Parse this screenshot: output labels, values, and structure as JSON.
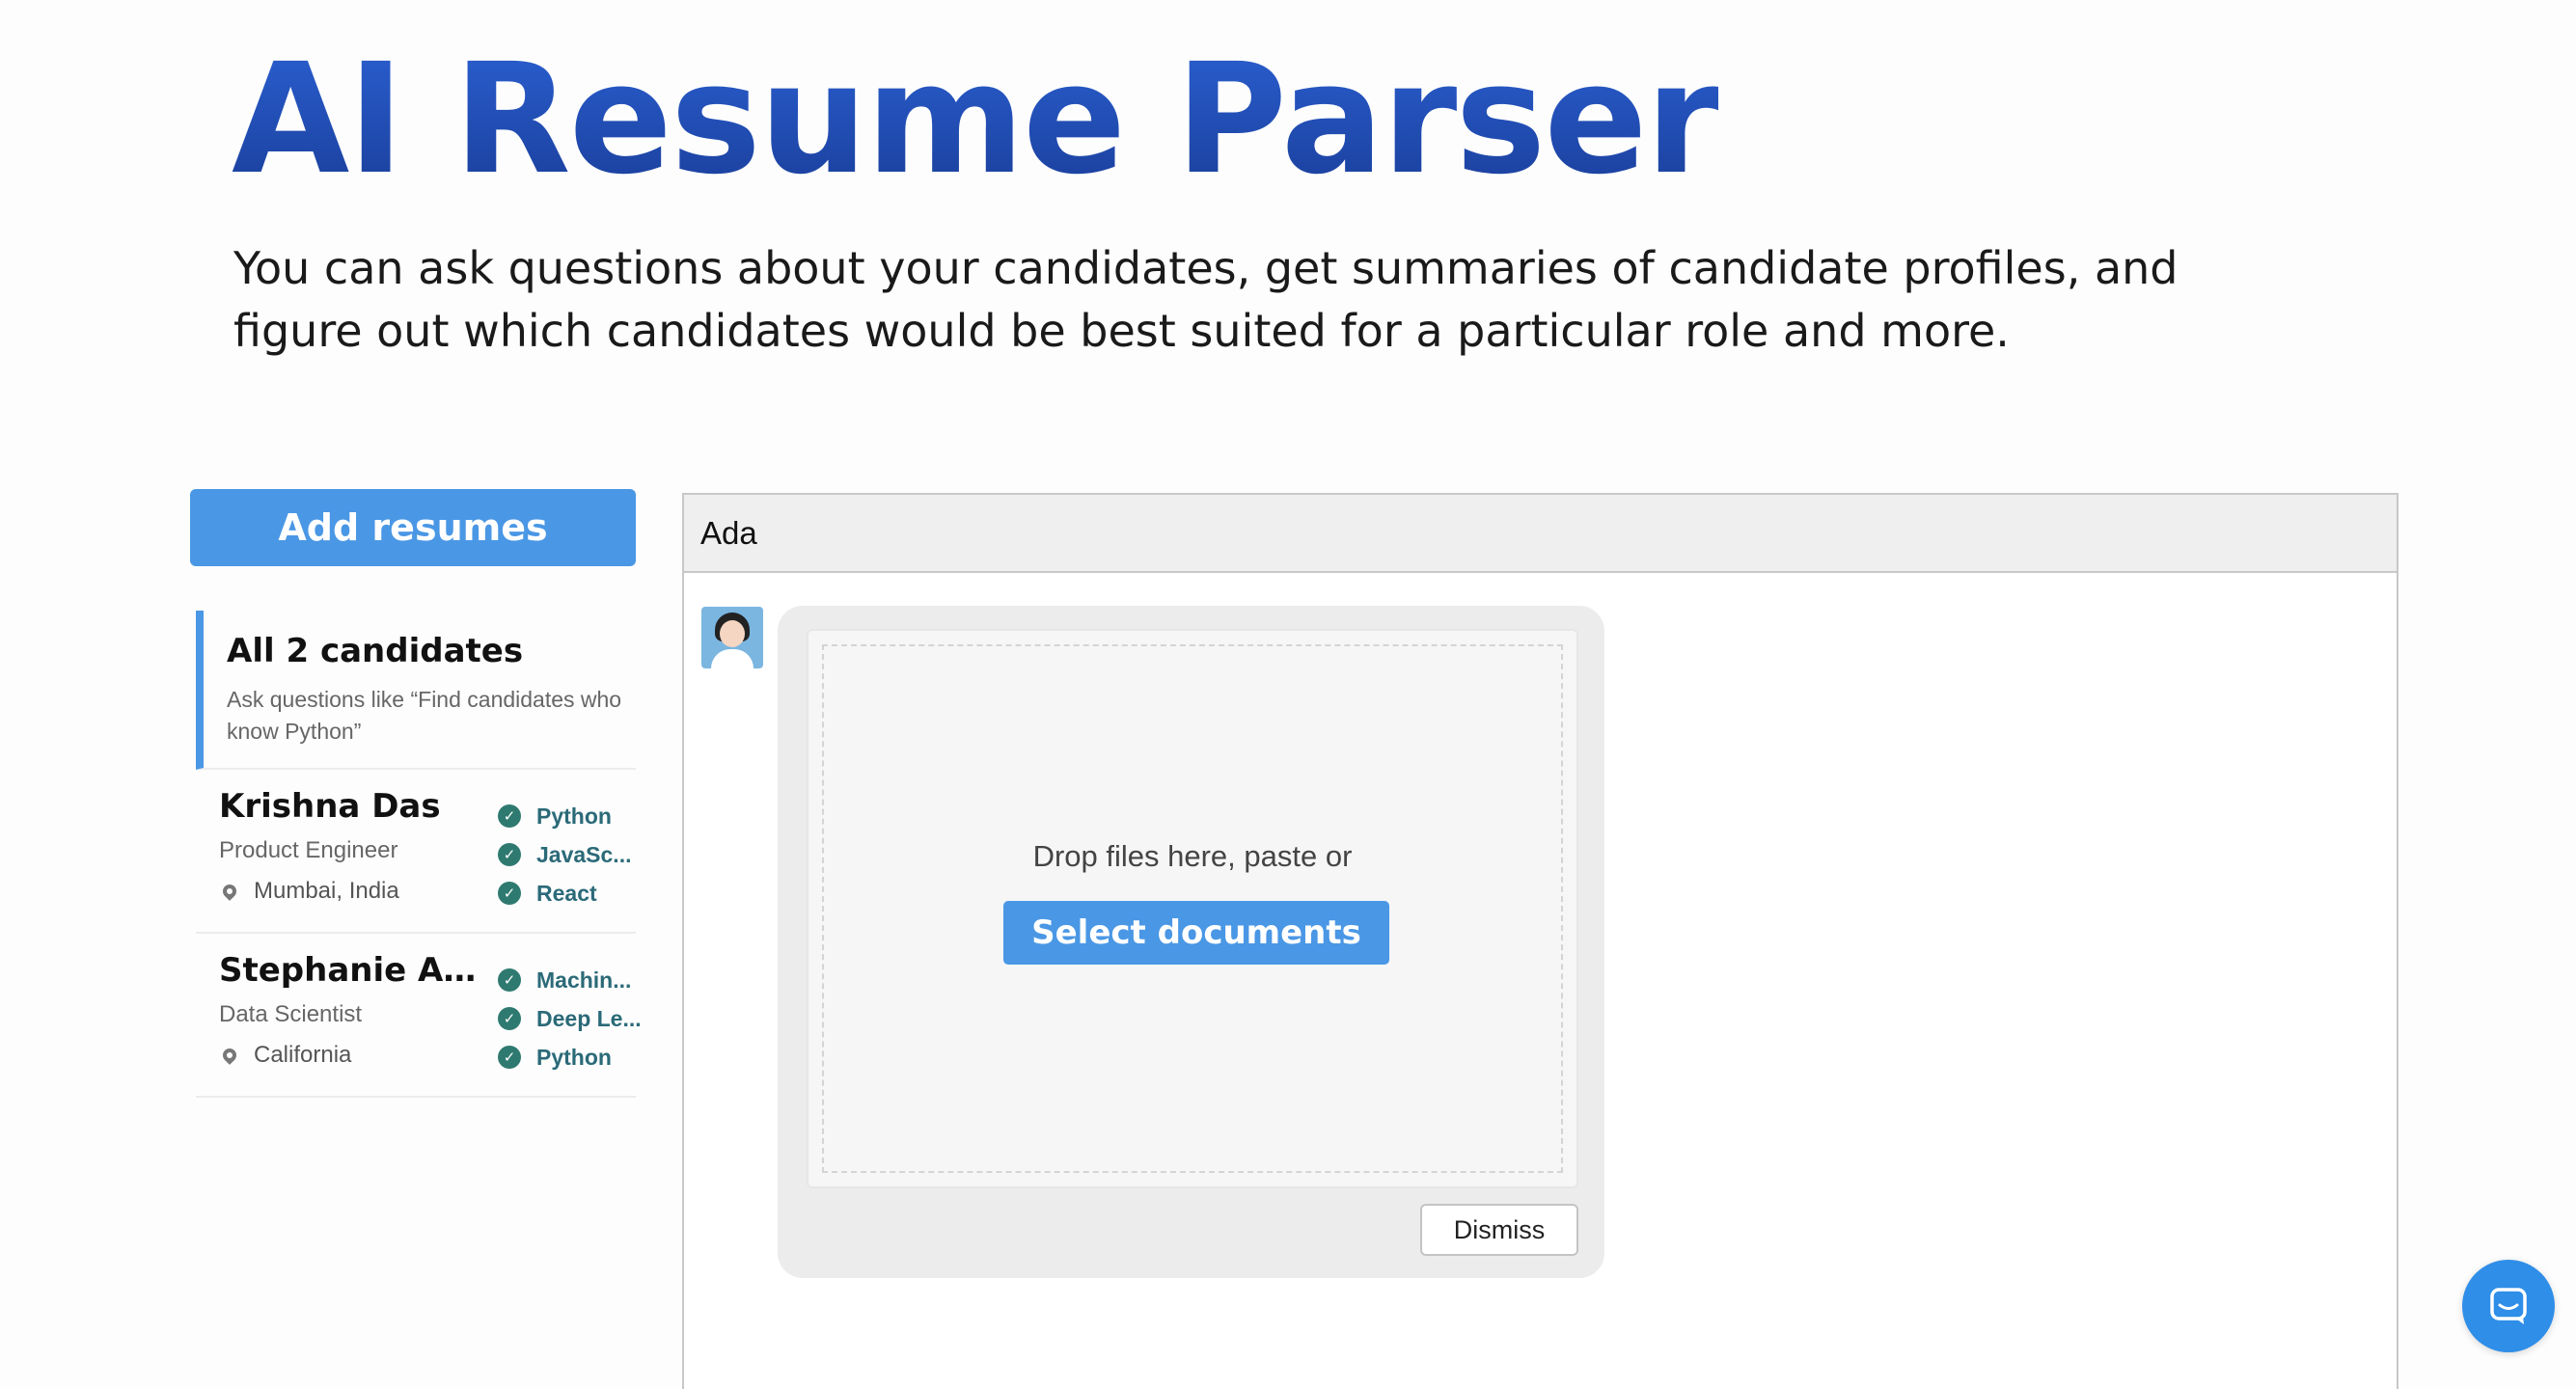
{
  "page": {
    "title": "AI Resume Parser",
    "subtitle": "You can ask questions about your candidates, get summaries of candidate profiles, and figure out which candidates would be best suited for a particular role and more."
  },
  "sidebar": {
    "add_button_label": "Add resumes",
    "all_candidates": {
      "title": "All 2 candidates",
      "hint": "Ask questions like “Find candidates who know Python”"
    },
    "candidates": [
      {
        "name": "Krishna Das",
        "role": "Product Engineer",
        "location": "Mumbai, India",
        "skills": [
          "Python",
          "JavaSc...",
          "React"
        ]
      },
      {
        "name": "Stephanie Ar...",
        "role": "Data Scientist",
        "location": "California",
        "skills": [
          "Machin...",
          "Deep Le...",
          "Python"
        ]
      }
    ]
  },
  "chat": {
    "header_title": "Ada",
    "upload": {
      "drop_text": "Drop files here, paste or",
      "select_button_label": "Select documents",
      "dismiss_button_label": "Dismiss"
    }
  },
  "icons": {
    "location": "map-pin-icon",
    "skill_check": "check-circle-icon",
    "launcher": "chat-bubble-icon",
    "avatar": "assistant-avatar"
  },
  "colors": {
    "accent": "#4a97e5",
    "title_gradient_top": "#2a5fd0",
    "title_gradient_bottom": "#1a3e9a",
    "skill_text": "#2b6a78",
    "check_bg": "#2f7a70",
    "launcher": "#2f8ee8"
  }
}
